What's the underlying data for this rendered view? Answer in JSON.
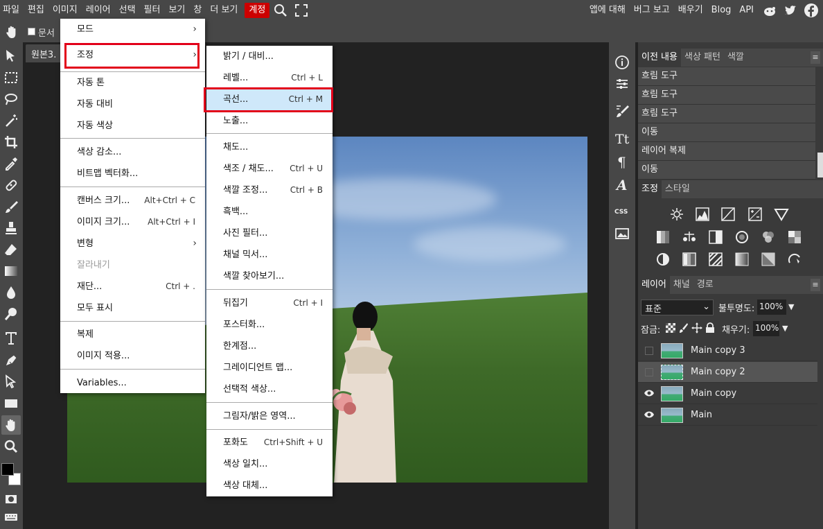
{
  "menubar": {
    "left": [
      "파일",
      "편집",
      "이미지",
      "레이어",
      "선택",
      "필터",
      "보기",
      "창",
      "더 보기",
      "계정"
    ],
    "right": [
      "앱에 대해",
      "버그 보고",
      "배우기",
      "Blog",
      "API"
    ]
  },
  "options": {
    "checkbox_label": "문서"
  },
  "doc_tab": {
    "label": "원본3."
  },
  "image_menu": {
    "items": [
      "모드",
      "조정",
      "자동 톤",
      "자동 대비",
      "자동 색상",
      "색상 감소...",
      "비트맵 벡터화...",
      "캔버스 크기...",
      "이미지 크기...",
      "변형",
      "잘라내기",
      "재단...",
      "모두 표시",
      "복제",
      "이미지 적용...",
      "Variables..."
    ],
    "shortcuts": {
      "canvas": "Alt+Ctrl + C",
      "imgsize": "Alt+Ctrl + I",
      "trim": "Ctrl + ."
    }
  },
  "adjust_menu": {
    "items": [
      "밝기 / 대비...",
      "레벨...",
      "곡선...",
      "노출...",
      "채도...",
      "색조 / 채도...",
      "색깔 조정...",
      "흑백...",
      "사진 필터...",
      "채널 믹서...",
      "색깔 찾아보기...",
      "뒤집기",
      "포스터화...",
      "한계점...",
      "그레이디언트 맵...",
      "선택적 색상...",
      "그림자/밝은 영역...",
      "포화도",
      "색상 일치...",
      "색상 대체..."
    ],
    "shortcuts": {
      "levels": "Ctrl + L",
      "curves": "Ctrl + M",
      "hue": "Ctrl + U",
      "balance": "Ctrl + B",
      "invert": "Ctrl + I",
      "vibrance": "Ctrl+Shift + U"
    }
  },
  "history_tabs": [
    "이전 내용",
    "색상 패턴",
    "색깔"
  ],
  "history": [
    "흐림 도구",
    "흐림 도구",
    "흐림 도구",
    "이동",
    "레이어 복제",
    "이동"
  ],
  "adj_tabs": [
    "조정",
    "스타일"
  ],
  "layer_tabs": [
    "레이어",
    "채널",
    "경로"
  ],
  "layers_panel": {
    "blend_mode": "표준",
    "opacity_label": "불투명도:",
    "opacity": "100%",
    "lock_label": "잠금:",
    "fill_label": "채우기:",
    "fill": "100%"
  },
  "layers": [
    "Main copy 3",
    "Main copy 2",
    "Main copy",
    "Main"
  ],
  "colors": {
    "accent_red": "#e2001a",
    "highlight": "#cfe8fa",
    "panel": "#474747"
  }
}
